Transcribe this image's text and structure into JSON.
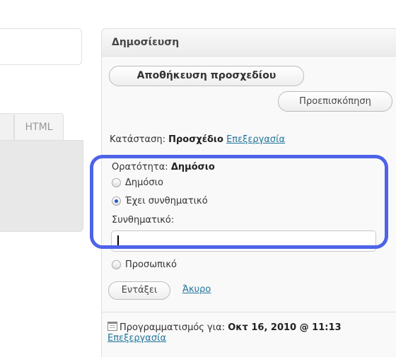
{
  "editor": {
    "tab_html": "HTML"
  },
  "publish": {
    "title": "Δημοσίευση",
    "save_draft_label": "Αποθήκευση προσχεδίου",
    "preview_label": "Προεπισκόπηση",
    "status_label": "Κατάσταση:",
    "status_value": "Προσχέδιο",
    "status_edit_link": "Επεξεργασία",
    "visibility_label": "Ορατότητα:",
    "visibility_value": "Δημόσιο",
    "visibility_options": [
      {
        "label": "Δημόσιο",
        "checked": false
      },
      {
        "label": "Έχει συνθηματικό",
        "checked": true
      },
      {
        "label": "Προσωπικό",
        "checked": false
      }
    ],
    "password_label": "Συνθηματικό:",
    "password_value": "",
    "ok_label": "Εντάξει",
    "cancel_label": "Άκυρο",
    "schedule_label": "Προγραμματισμός για:",
    "schedule_value": "Οκτ 16, 2010 @ 11:13",
    "schedule_edit_link": "Επεξεργασία"
  },
  "colors": {
    "link": "#21759b",
    "highlight": "#4e63e8",
    "radio_checked": "#1d5bc8"
  }
}
